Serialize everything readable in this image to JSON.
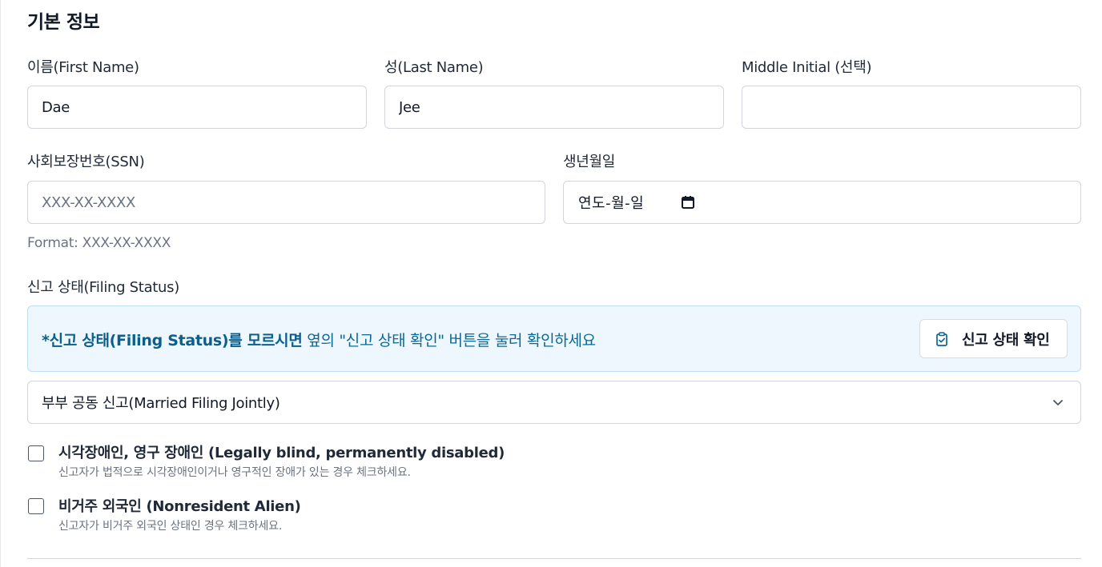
{
  "section": {
    "title": "기본 정보"
  },
  "first_name": {
    "label": "이름(First Name)",
    "value": "Dae"
  },
  "last_name": {
    "label": "성(Last Name)",
    "value": "Jee"
  },
  "middle_initial": {
    "label": "Middle Initial (선택)",
    "value": ""
  },
  "ssn": {
    "label": "사회보장번호(SSN)",
    "placeholder": "XXX-XX-XXXX",
    "hint": "Format: XXX-XX-XXXX"
  },
  "birthdate": {
    "label": "생년월일",
    "placeholder": "연도-월-일",
    "icon": "calendar-icon"
  },
  "filing_status": {
    "label": "신고 상태(Filing Status)",
    "info_bold": "*신고 상태(Filing Status)를 모르시면",
    "info_rest": " 옆의 \"신고 상태 확인\" 버튼을 눌러 확인하세요",
    "button_label": "신고 상태 확인",
    "button_icon": "clipboard-check-icon",
    "selected": "부부 공동 신고(Married Filing Jointly)"
  },
  "checkboxes": [
    {
      "title": "시각장애인, 영구 장애인 (Legally blind, permanently disabled)",
      "description": "신고자가 법적으로 시각장애인이거나 영구적인 장애가 있는 경우 체크하세요.",
      "checked": false
    },
    {
      "title": "비거주 외국인 (Nonresident Alien)",
      "description": "신고자가 비거주 외국인 상태인 경우 체크하세요.",
      "checked": false
    }
  ],
  "colors": {
    "info_bg": "#eef7fd",
    "info_text": "#0b6896",
    "border": "#d1d5db"
  }
}
